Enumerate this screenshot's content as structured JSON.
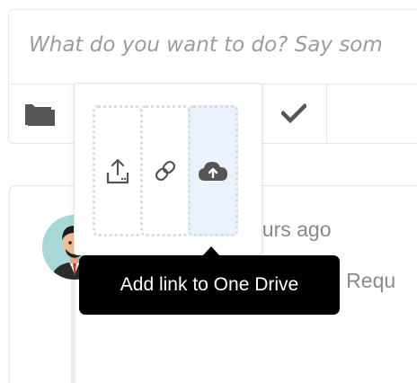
{
  "composer": {
    "placeholder": "What do you want to do? Say som"
  },
  "toolbar": {
    "folder_icon": "folder-icon",
    "submit_icon": "checkmark-icon"
  },
  "attach_menu": {
    "options": [
      {
        "icon": "upload-icon"
      },
      {
        "icon": "link-icon"
      },
      {
        "icon": "cloud-upload-icon"
      }
    ],
    "active_color": "#eaf3fd"
  },
  "tooltip": {
    "text": "Add link to One Drive"
  },
  "feed": {
    "post_time": "ours ago",
    "post_text": "o Requ"
  }
}
